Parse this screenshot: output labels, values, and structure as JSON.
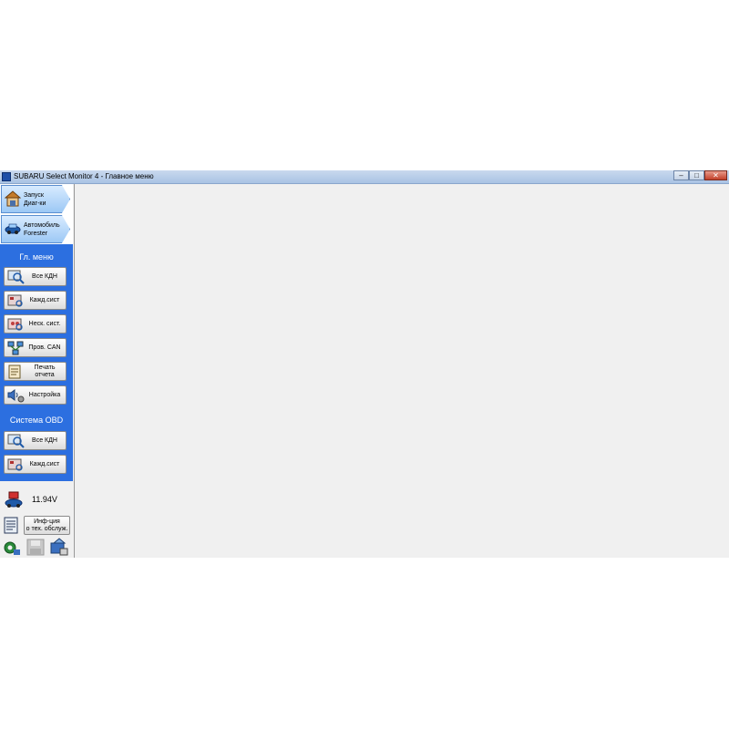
{
  "window": {
    "title": "SUBARU Select Monitor 4 - Главное меню",
    "controls": {
      "minimize": "–",
      "maximize": "□",
      "close": "✕"
    }
  },
  "sidebar": {
    "start_diag": {
      "line1": "Запуск",
      "line2": "Диаг-ки",
      "icon": "garage-icon"
    },
    "vehicle": {
      "line1": "Автомобиль",
      "line2": "Forester",
      "icon": "car-key-icon"
    },
    "main_menu_label": "Гл. меню",
    "main_menu": [
      {
        "label": "Все КДН",
        "icon": "dtc-search-icon"
      },
      {
        "label": "Кажд.сист",
        "icon": "each-system-icon"
      },
      {
        "label": "Неск. сист.",
        "icon": "multi-system-icon"
      },
      {
        "label": "Пров. CAN",
        "icon": "can-check-icon"
      },
      {
        "label_line1": "Печать",
        "label_line2": "отчета",
        "icon": "print-report-icon"
      },
      {
        "label": "Настройка",
        "icon": "settings-icon"
      }
    ],
    "obd_label": "Система OBD",
    "obd_menu": [
      {
        "label": "Все КДН",
        "icon": "dtc-search-icon"
      },
      {
        "label": "Кажд.сист",
        "icon": "each-system-icon"
      }
    ],
    "voltage": "11.94V",
    "service_info": {
      "line1": "Инф-ция",
      "line2": "о тех. обслуж."
    }
  },
  "colors": {
    "sidebar_blue": "#2c6fe0",
    "arrow_button": "#9cc8f5",
    "title_bar": "#a9c3e4",
    "main_background": "#f0f0f0"
  }
}
